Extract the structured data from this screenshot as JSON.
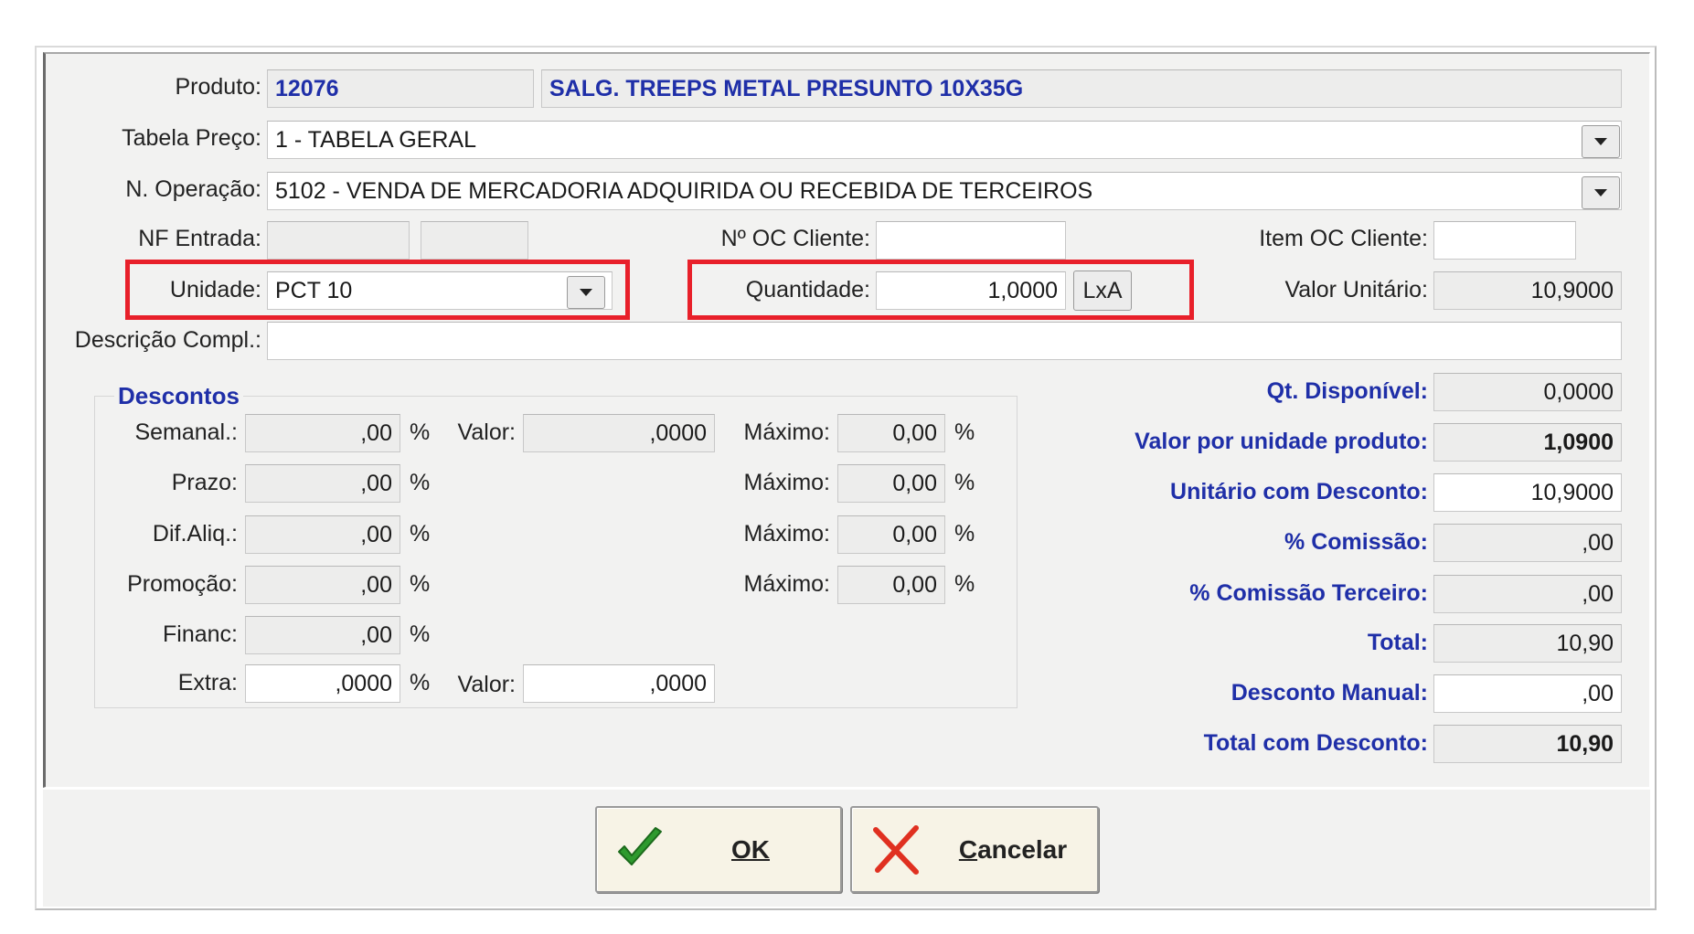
{
  "header": {
    "produto_label": "Produto:",
    "produto_code": "12076",
    "produto_name": "SALG. TREEPS METAL PRESUNTO 10X35G",
    "tabela_label": "Tabela Preço:",
    "tabela_value": "1 - TABELA GERAL",
    "operacao_label": "N. Operação:",
    "operacao_value": "5102 - VENDA DE MERCADORIA ADQUIRIDA OU RECEBIDA DE TERCEIROS",
    "nf_label": "NF Entrada:",
    "nf_value1": "",
    "nf_value2": "",
    "oc_label": "Nº OC Cliente:",
    "oc_value": "",
    "item_oc_label": "Item OC Cliente:",
    "item_oc_value": "",
    "unidade_label": "Unidade:",
    "unidade_value": "PCT 10",
    "quantidade_label": "Quantidade:",
    "quantidade_value": "1,0000",
    "lxa_label": "LxA",
    "valor_unitario_label": "Valor Unitário:",
    "valor_unitario_value": "10,9000",
    "descricao_label": "Descrição Compl.:",
    "descricao_value": ""
  },
  "descontos": {
    "title": "Descontos",
    "pct_symbol": "%",
    "valor_label": "Valor:",
    "maximo_label": "Máximo:",
    "rows": [
      {
        "label": "Semanal.:",
        "value": ",00",
        "valor": ",0000",
        "maximo": "0,00"
      },
      {
        "label": "Prazo:",
        "value": ",00",
        "maximo": "0,00"
      },
      {
        "label": "Dif.Aliq.:",
        "value": ",00",
        "maximo": "0,00"
      },
      {
        "label": "Promoção:",
        "value": ",00",
        "maximo": "0,00"
      },
      {
        "label": "Financ:",
        "value": ",00"
      },
      {
        "label": "Extra:",
        "value": ",0000",
        "valor": ",0000"
      }
    ]
  },
  "totals": [
    {
      "label": "Qt. Disponível:",
      "value": "0,0000"
    },
    {
      "label": "Valor por unidade produto:",
      "value": "1,0900"
    },
    {
      "label": "Unitário com Desconto:",
      "value": "10,9000"
    },
    {
      "label": "% Comissão:",
      "value": ",00"
    },
    {
      "label": "% Comissão Terceiro:",
      "value": ",00"
    },
    {
      "label": "Total:",
      "value": "10,90"
    },
    {
      "label": "Desconto Manual:",
      "value": ",00"
    },
    {
      "label": "Total com Desconto:",
      "value": "10,90"
    }
  ],
  "buttons": {
    "ok_label": "OK",
    "cancel_label": "Cancelar"
  },
  "colors": {
    "label_blue": "#1f2fa8",
    "highlight_red": "#e8202a",
    "ok_green": "#2e9a2e",
    "cancel_red": "#e03020"
  }
}
